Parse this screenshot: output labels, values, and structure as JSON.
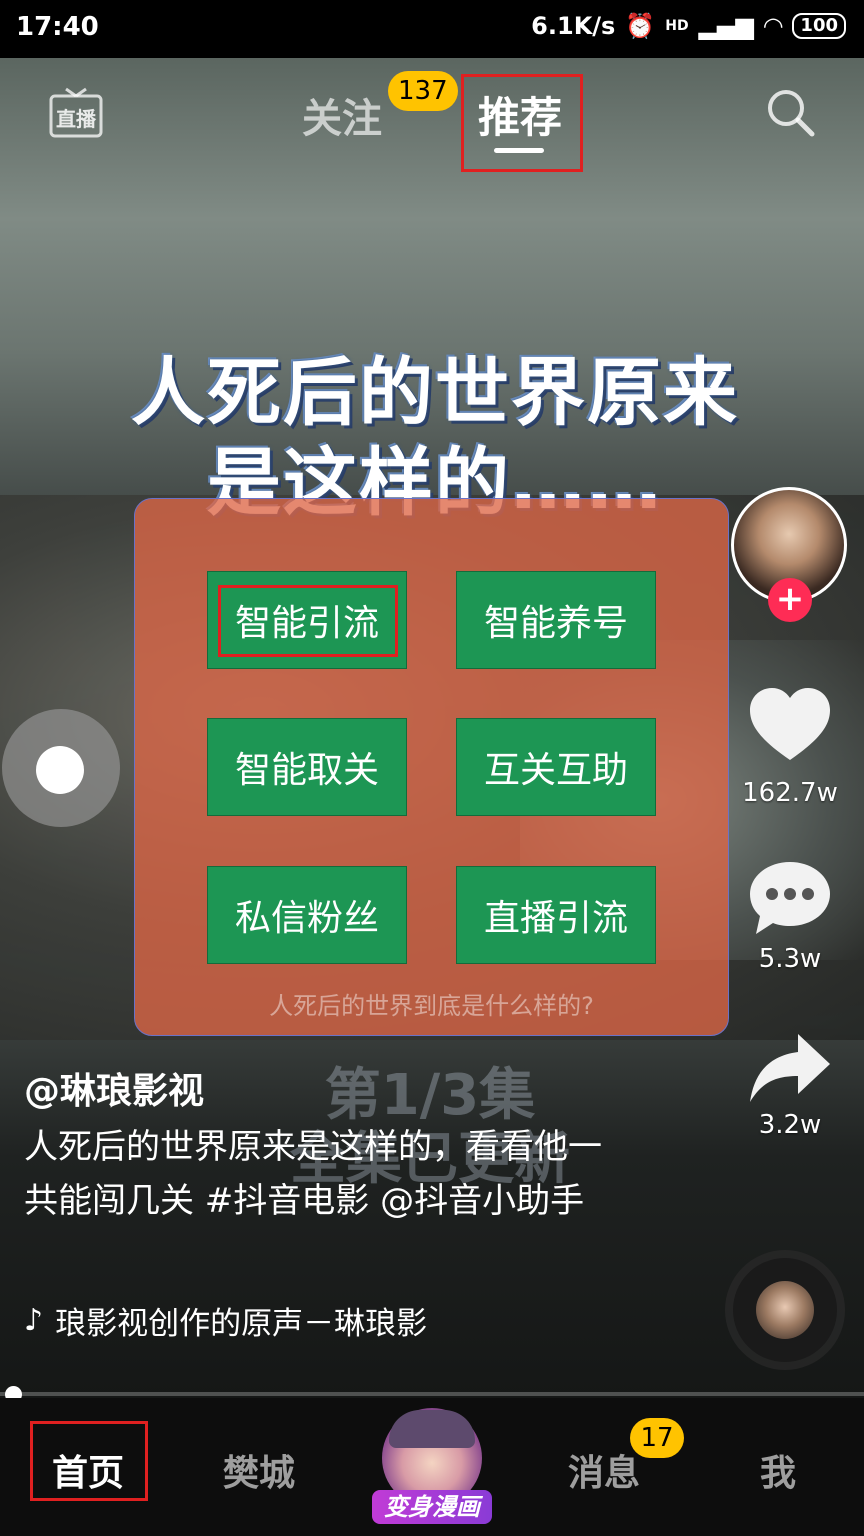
{
  "status_bar": {
    "time": "17:40",
    "speed": "6.1K/s",
    "signal1": "HD",
    "battery": "100"
  },
  "top_nav": {
    "live_label": "直播",
    "follow_label": "关注",
    "follow_badge": "137",
    "recommend_label": "推荐"
  },
  "video": {
    "overlay_title_line1": "人死后的世界原来",
    "overlay_title_line2": "是这样的……",
    "episode_line1": "第1/3集",
    "episode_line2": "全集已更新",
    "author": "@琳琅影视",
    "description": "人死后的世界原来是这样的，看看他一共能闯几关 #抖音电影 @抖音小助手",
    "music": "琅影视创作的原声－琳琅影"
  },
  "panel": {
    "buttons": [
      "智能引流",
      "智能养号",
      "智能取关",
      "互关互助",
      "私信粉丝",
      "直播引流"
    ],
    "caption": "人死后的世界到底是什么样的?"
  },
  "side_actions": {
    "likes": "162.7w",
    "comments": "5.3w",
    "shares": "3.2w"
  },
  "tab_bar": {
    "home": "首页",
    "city": "樊城",
    "center_label": "变身漫画",
    "messages": "消息",
    "messages_badge": "17",
    "me": "我"
  },
  "progress": 0.01,
  "colors": {
    "accent_red": "#fe2c55",
    "badge_yellow": "#ffc300",
    "button_green": "#1d9654",
    "panel_orange": "#de6646"
  }
}
